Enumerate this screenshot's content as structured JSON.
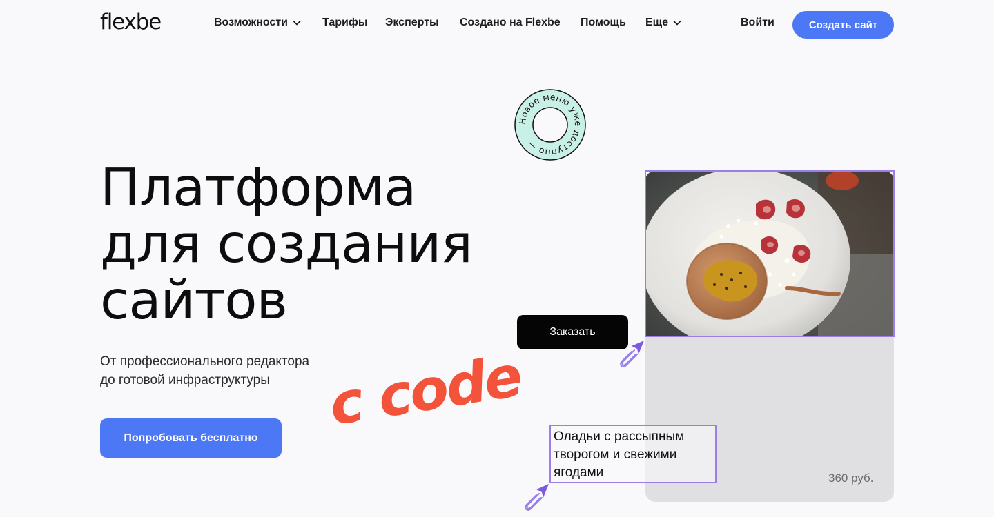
{
  "header": {
    "logo": "flexbe",
    "nav": [
      {
        "label": "Возможности",
        "dropdown": true
      },
      {
        "label": "Тарифы",
        "dropdown": false
      },
      {
        "label": "Эксперты",
        "dropdown": false
      },
      {
        "label": "Создано на Flexbe",
        "dropdown": false
      },
      {
        "label": "Помощь",
        "dropdown": false
      },
      {
        "label": "Еще",
        "dropdown": true
      }
    ],
    "login": "Войти",
    "create_site": "Создать сайт"
  },
  "hero": {
    "title_lines": [
      "Платформа",
      "для создания",
      "сайтов"
    ],
    "subtitle_lines": [
      "От профессионального редактора",
      "до готовой инфраструктуры"
    ],
    "cta": "Попробовать бесплатно"
  },
  "badge": {
    "text": "Новое меню уже доступно — "
  },
  "decor": {
    "code_text": "c code"
  },
  "card": {
    "order_button": "Заказать",
    "dish_name_lines": [
      "Оладьи с рассыпным",
      "творогом и свежими",
      "ягодами"
    ],
    "price": "360 руб."
  },
  "colors": {
    "accent": "#4c77f5",
    "selection": "#9a7fe8",
    "badge_fill": "#c9f0e6",
    "code_red": "#f2533a",
    "card_bg": "#e0e0e3"
  }
}
